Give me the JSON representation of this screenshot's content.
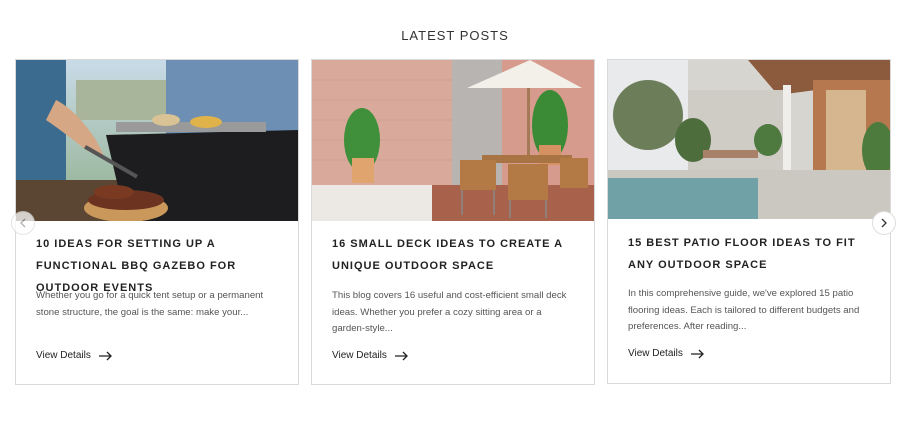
{
  "section": {
    "title": "LATEST POSTS"
  },
  "posts": [
    {
      "title": "10 IDEAS FOR SETTING UP A FUNCTIONAL BBQ GAZEBO FOR OUTDOOR EVENTS",
      "excerpt": "Whether you go for a quick tent setup or a permanent stone structure, the goal is the same: make your...",
      "link_label": "View Details"
    },
    {
      "title": "16 SMALL DECK IDEAS TO CREATE A UNIQUE OUTDOOR SPACE",
      "excerpt": "This blog covers 16 useful and cost-efficient small deck ideas. Whether you prefer a cozy sitting area or a garden-style...",
      "link_label": "View Details"
    },
    {
      "title": "15 BEST PATIO FLOOR IDEAS TO FIT ANY OUTDOOR SPACE",
      "excerpt": "In this comprehensive guide, we've explored 15 patio flooring ideas. Each is tailored to different budgets and preferences. After reading...",
      "link_label": "View Details"
    }
  ],
  "icons": {
    "prev": "chevron-left-icon",
    "next": "chevron-right-icon",
    "link": "arrow-right-icon"
  }
}
